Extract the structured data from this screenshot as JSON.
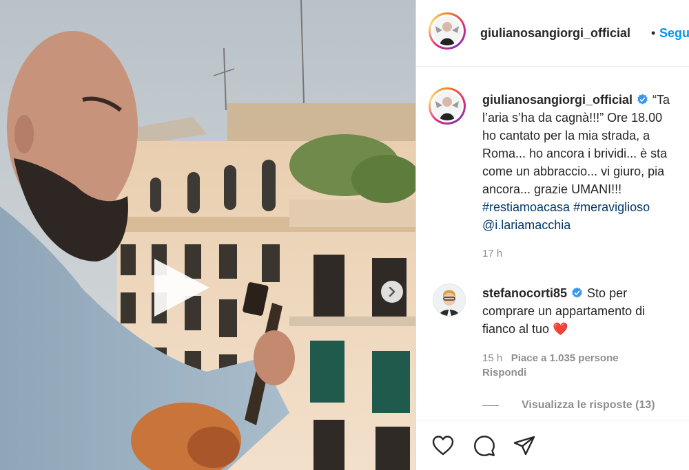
{
  "colors": {
    "accent": "#0095f6",
    "hashtag": "#00376b",
    "muted": "#8e8e8e",
    "heart": "#ed1c24"
  },
  "media": {
    "play_icon": "play-icon",
    "next_icon": "chevron-right-icon"
  },
  "header": {
    "username": "giulianosangiorgi_official",
    "separator": "•",
    "follow_label": "Segui"
  },
  "caption": {
    "username": "giulianosangiorgi_official",
    "lines": [
      "“Ta",
      "l’aria s’ha da cagnà!!!” Ore 18.00",
      "ho cantato per la mia strada, a",
      "Roma... ho ancora i brividi... è sta",
      "come un abbraccio... vi giuro, pia",
      "ancora... grazie UMANI!!!"
    ],
    "hashtags": [
      "#restiamoacasa",
      "#meraviglioso"
    ],
    "mention": "@i.lariamacchia",
    "time": "17 h"
  },
  "comment": {
    "username": "stefanocorti85",
    "lines": [
      "Sto per",
      "comprare un appartamento di",
      "fianco al tuo"
    ],
    "emoji": "❤️",
    "time": "15 h",
    "likes": "Piace a 1.035 persone",
    "reply_label": "Rispondi",
    "view_replies": "Visualizza le risposte (13)"
  },
  "actions": {
    "like_icon": "heart-icon",
    "comment_icon": "comment-icon",
    "share_icon": "share-icon"
  }
}
